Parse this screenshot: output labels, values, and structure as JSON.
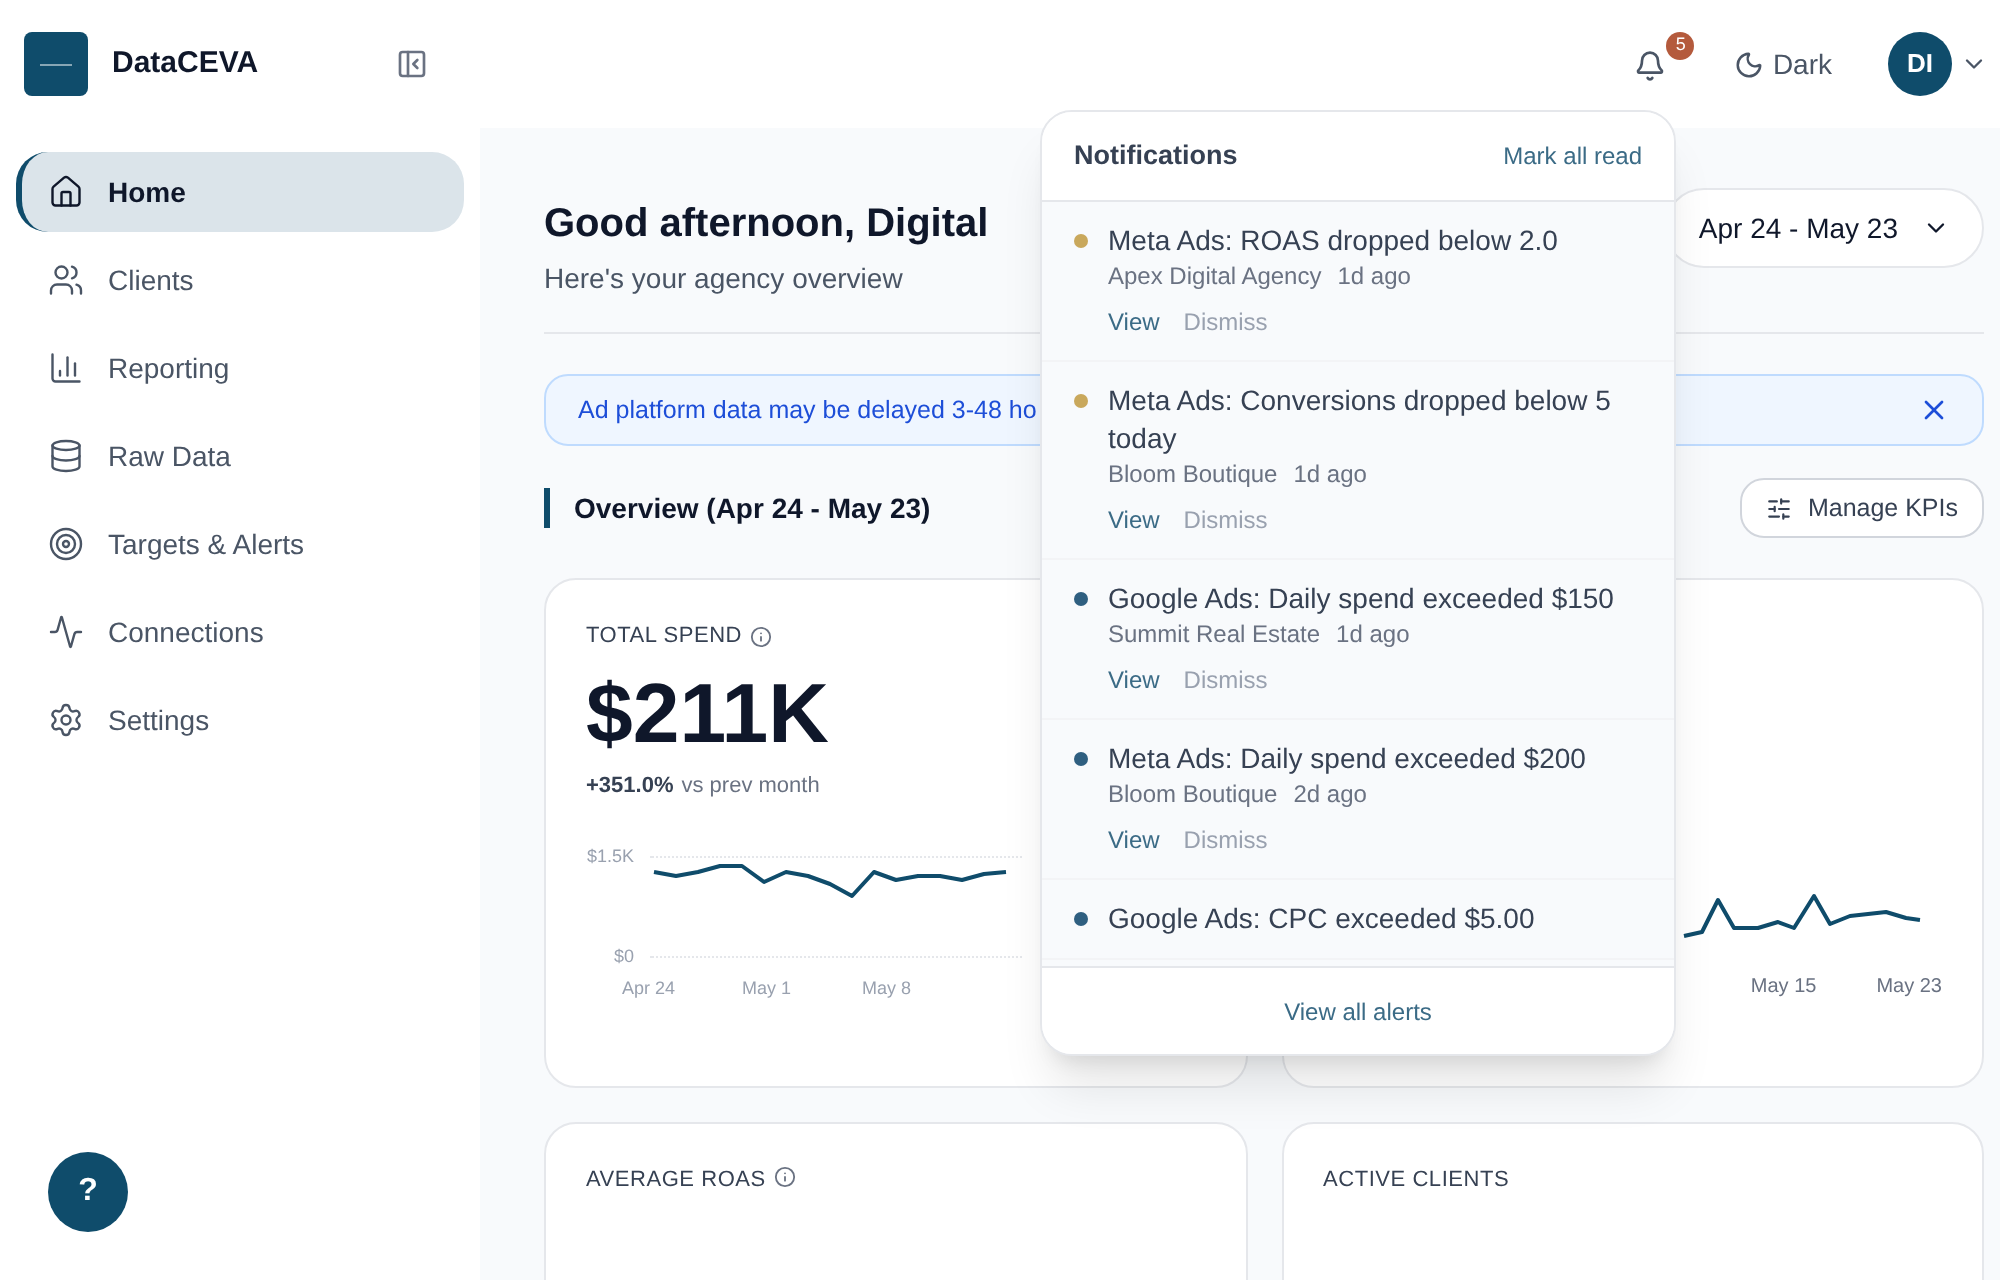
{
  "brand": {
    "name": "DataCEVA"
  },
  "sidebar": {
    "items": [
      {
        "label": "Home",
        "selected": true
      },
      {
        "label": "Clients",
        "selected": false
      },
      {
        "label": "Reporting",
        "selected": false
      },
      {
        "label": "Raw Data",
        "selected": false
      },
      {
        "label": "Targets & Alerts",
        "selected": false
      },
      {
        "label": "Connections",
        "selected": false
      },
      {
        "label": "Settings",
        "selected": false
      }
    ],
    "help": "?"
  },
  "header": {
    "notification_count": "5",
    "theme_label": "Dark",
    "avatar": "DI"
  },
  "greeting": {
    "title": "Good afternoon, Digital",
    "subtitle": "Here's your agency overview",
    "date_range": "Apr 24 - May 23"
  },
  "banner": {
    "text": "Ad platform data may be delayed 3-48 ho"
  },
  "overview": {
    "title": "Overview (Apr 24 - May 23)",
    "buttons": [
      {
        "label": "Manage KPIs"
      }
    ]
  },
  "cards": [
    {
      "label": "TOTAL SPEND",
      "value": "$211K",
      "change": "+351.0%",
      "change_note": "vs prev month",
      "y_labels": [
        "$1.5K",
        "$0"
      ],
      "x_labels": [
        "Apr 24",
        "May 1",
        "May 8"
      ]
    },
    {
      "x_labels": [
        "May 15",
        "May 23"
      ]
    }
  ],
  "bottom_cards": [
    {
      "label": "AVERAGE ROAS",
      "info": true
    },
    {
      "label": "ACTIVE CLIENTS",
      "info": false
    }
  ],
  "notifications": {
    "title": "Notifications",
    "mark_all": "Mark all read",
    "footer": "View all alerts",
    "items": [
      {
        "title": "Meta Ads: ROAS dropped below 2.0",
        "client": "Apex Digital Agency",
        "time": "1d ago",
        "color": "#c9a85c",
        "actions": [
          "View",
          "Dismiss"
        ]
      },
      {
        "title": "Meta Ads: Conversions dropped below 5 today",
        "client": "Bloom Boutique",
        "time": "1d ago",
        "color": "#c9a85c",
        "actions": [
          "View",
          "Dismiss"
        ]
      },
      {
        "title": "Google Ads: Daily spend exceeded $150",
        "client": "Summit Real Estate",
        "time": "1d ago",
        "color": "#2f5f80",
        "actions": [
          "View",
          "Dismiss"
        ]
      },
      {
        "title": "Meta Ads: Daily spend exceeded $200",
        "client": "Bloom Boutique",
        "time": "2d ago",
        "color": "#2f5f80",
        "actions": [
          "View",
          "Dismiss"
        ]
      },
      {
        "title": "Google Ads: CPC exceeded $5.00",
        "color": "#2f5f80"
      }
    ]
  }
}
